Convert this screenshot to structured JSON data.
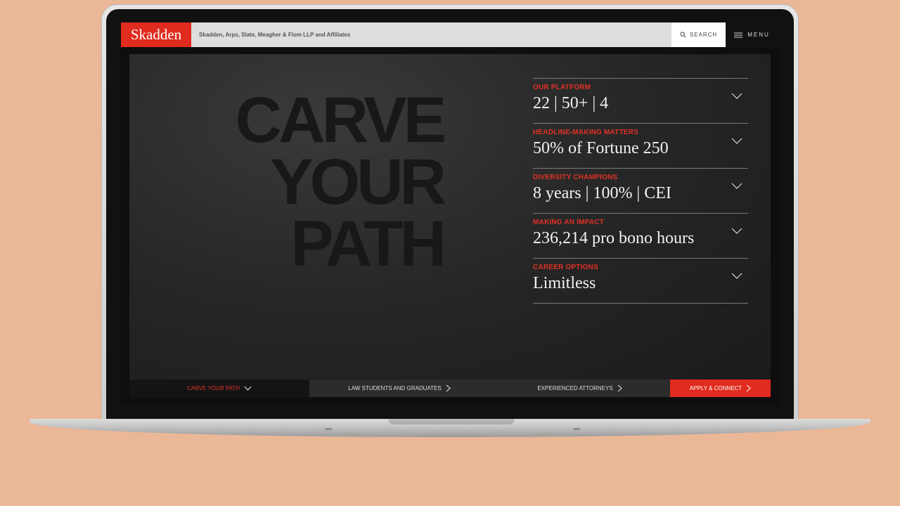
{
  "header": {
    "logo": "Skadden",
    "firm_name": "Skadden, Arps, Slate, Meagher & Flom LLP and Affiliates",
    "search_label": "SEARCH",
    "menu_label": "MENU"
  },
  "hero": {
    "headline_lines": [
      "CARVE",
      "YOUR",
      "PATH"
    ]
  },
  "accordion": [
    {
      "category": "OUR PLATFORM",
      "value": "22 | 50+ | 4"
    },
    {
      "category": "HEADLINE-MAKING MATTERS",
      "value": "50% of Fortune 250"
    },
    {
      "category": "DIVERSITY CHAMPIONS",
      "value": "8 years | 100% | CEI"
    },
    {
      "category": "MAKING AN IMPACT",
      "value": "236,214 pro bono hours"
    },
    {
      "category": "CAREER OPTIONS",
      "value": "Limitless"
    }
  ],
  "bottom_nav": [
    {
      "label": "CARVE YOUR PATH"
    },
    {
      "label": "LAW STUDENTS AND GRADUATES"
    },
    {
      "label": "EXPERIENCED ATTORNEYS"
    },
    {
      "label": "APPLY & CONNECT"
    }
  ],
  "colors": {
    "brand_red": "#e12b1e",
    "background": "#eab797",
    "hero_text": "#181818"
  }
}
